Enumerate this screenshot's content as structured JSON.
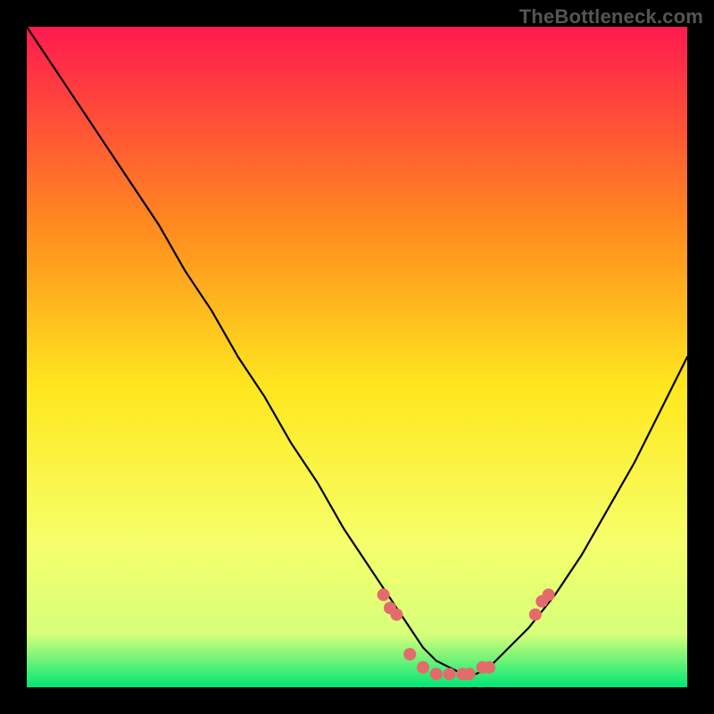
{
  "watermark": "TheBottleneck.com",
  "gradient": {
    "top": "#ff1a4f",
    "upper_mid": "#ff8a1f",
    "mid": "#ffe81f",
    "lower_mid": "#f6ff6a",
    "near_bottom": "#d6ff7a",
    "bottom": "#00e676"
  },
  "chart_data": {
    "type": "line",
    "title": "",
    "xlabel": "",
    "ylabel": "",
    "xlim": [
      0,
      100
    ],
    "ylim": [
      0,
      100
    ],
    "curve": {
      "name": "bottleneck-curve",
      "x": [
        0,
        4,
        8,
        12,
        16,
        20,
        24,
        28,
        32,
        36,
        40,
        44,
        48,
        52,
        56,
        58,
        60,
        62,
        64,
        66,
        68,
        70,
        72,
        76,
        80,
        84,
        88,
        92,
        96,
        100
      ],
      "y": [
        100,
        94,
        88,
        82,
        76,
        70,
        63,
        57,
        50,
        44,
        37,
        31,
        24,
        18,
        12,
        9,
        6,
        4,
        3,
        2,
        2,
        3,
        5,
        9,
        14,
        20,
        27,
        34,
        42,
        50
      ]
    },
    "markers": {
      "name": "highlight-points",
      "color": "#e36b6b",
      "x": [
        54,
        55,
        56,
        58,
        60,
        62,
        64,
        66,
        67,
        69,
        70,
        77,
        78,
        79
      ],
      "y": [
        14,
        12,
        11,
        5,
        3,
        2,
        2,
        2,
        2,
        3,
        3,
        11,
        13,
        14
      ]
    }
  }
}
